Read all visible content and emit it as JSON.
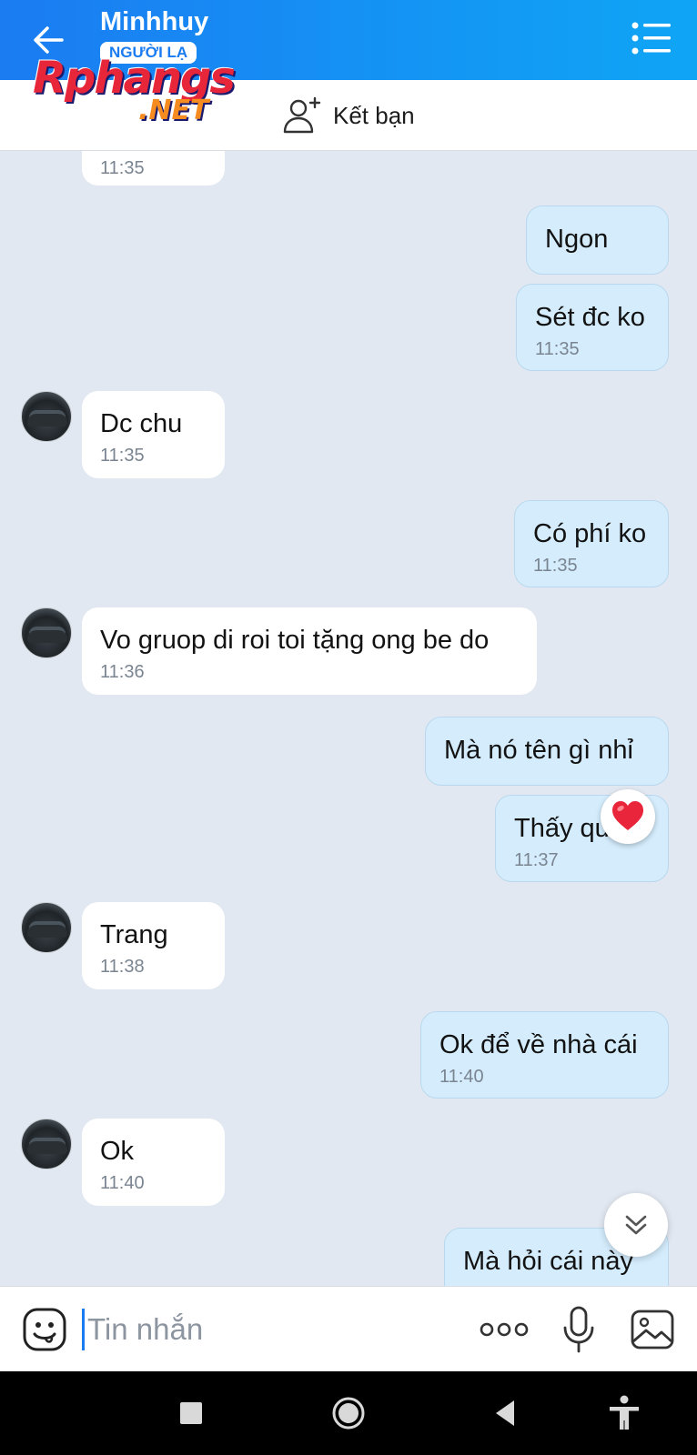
{
  "header": {
    "contact_name": "Minhhuy",
    "badge": "NGƯỜI LẠ"
  },
  "watermark": {
    "main": "Rphangs",
    "suffix": ".NET"
  },
  "friend_bar": {
    "add_friend_label": "Kết bạn"
  },
  "messages": [
    {
      "dir": "in",
      "text": "",
      "time": "11:35"
    },
    {
      "dir": "out",
      "text": "Ngon",
      "time": ""
    },
    {
      "dir": "out",
      "text": "Sét đc ko",
      "time": "11:35"
    },
    {
      "dir": "in",
      "text": "Dc chu",
      "time": "11:35"
    },
    {
      "dir": "out",
      "text": "Có phí ko",
      "time": "11:35"
    },
    {
      "dir": "in",
      "text": "Vo gruop di roi toi tặng ong be do",
      "time": "11:36"
    },
    {
      "dir": "out",
      "text": "Mà nó tên gì nhỉ",
      "time": ""
    },
    {
      "dir": "out",
      "text": "Thấy quên",
      "time": "11:37"
    },
    {
      "dir": "in",
      "text": "Trang",
      "time": "11:38"
    },
    {
      "dir": "out",
      "text": "Ok để về nhà cái",
      "time": "11:40"
    },
    {
      "dir": "in",
      "text": "Ok",
      "time": "11:40"
    },
    {
      "dir": "out",
      "text": "Mà hỏi cái này",
      "time": ""
    }
  ],
  "input": {
    "placeholder": "Tin nhắn"
  },
  "colors": {
    "header_start": "#1b7cf2",
    "header_end": "#0fa5f5",
    "chat_bg": "#e2e8f1",
    "outgoing_bubble": "#d4ecfc",
    "incoming_bubble": "#ffffff",
    "reaction_heart": "#e8253a"
  },
  "icons": {
    "back": "arrow-left-icon",
    "menu": "list-menu-icon",
    "add_friend": "user-plus-icon",
    "reaction": "heart-icon",
    "scroll": "chevrons-down-icon",
    "emoji": "sticker-face-icon",
    "more": "more-dots-icon",
    "mic": "microphone-icon",
    "image": "image-icon"
  }
}
